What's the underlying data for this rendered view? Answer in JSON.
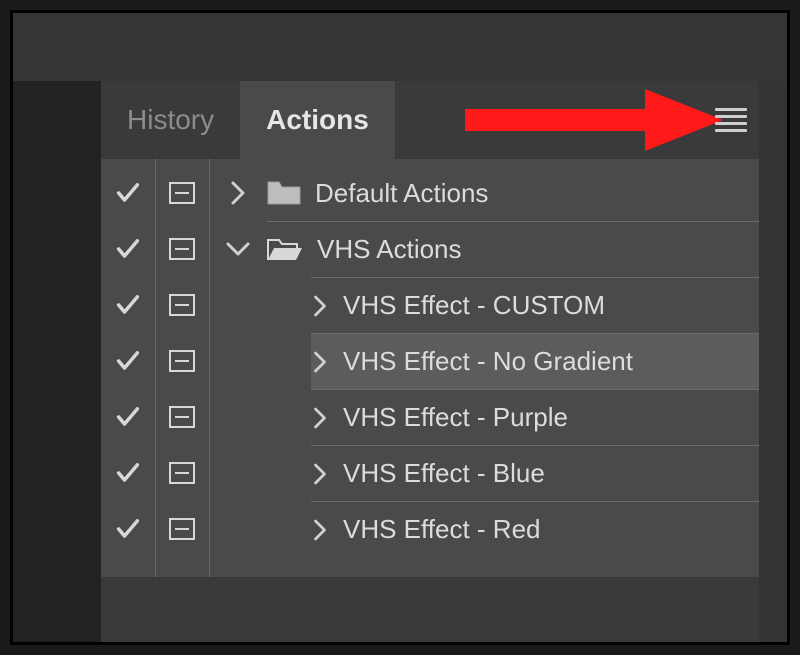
{
  "tabs": {
    "history": "History",
    "actions": "Actions",
    "active": "actions"
  },
  "rows": [
    {
      "label": "Default Actions",
      "type": "folder-closed",
      "indent": 0,
      "expanded": false,
      "selected": false
    },
    {
      "label": "VHS Actions",
      "type": "folder-open",
      "indent": 0,
      "expanded": true,
      "selected": false
    },
    {
      "label": "VHS Effect - CUSTOM",
      "type": "action",
      "indent": 1,
      "expanded": false,
      "selected": false
    },
    {
      "label": "VHS Effect - No Gradient",
      "type": "action",
      "indent": 1,
      "expanded": false,
      "selected": true
    },
    {
      "label": "VHS Effect - Purple",
      "type": "action",
      "indent": 1,
      "expanded": false,
      "selected": false
    },
    {
      "label": "VHS Effect - Blue",
      "type": "action",
      "indent": 1,
      "expanded": false,
      "selected": false
    },
    {
      "label": "VHS Effect - Red",
      "type": "action",
      "indent": 1,
      "expanded": false,
      "selected": false
    }
  ],
  "annotation": {
    "color": "#ff1a1a"
  }
}
